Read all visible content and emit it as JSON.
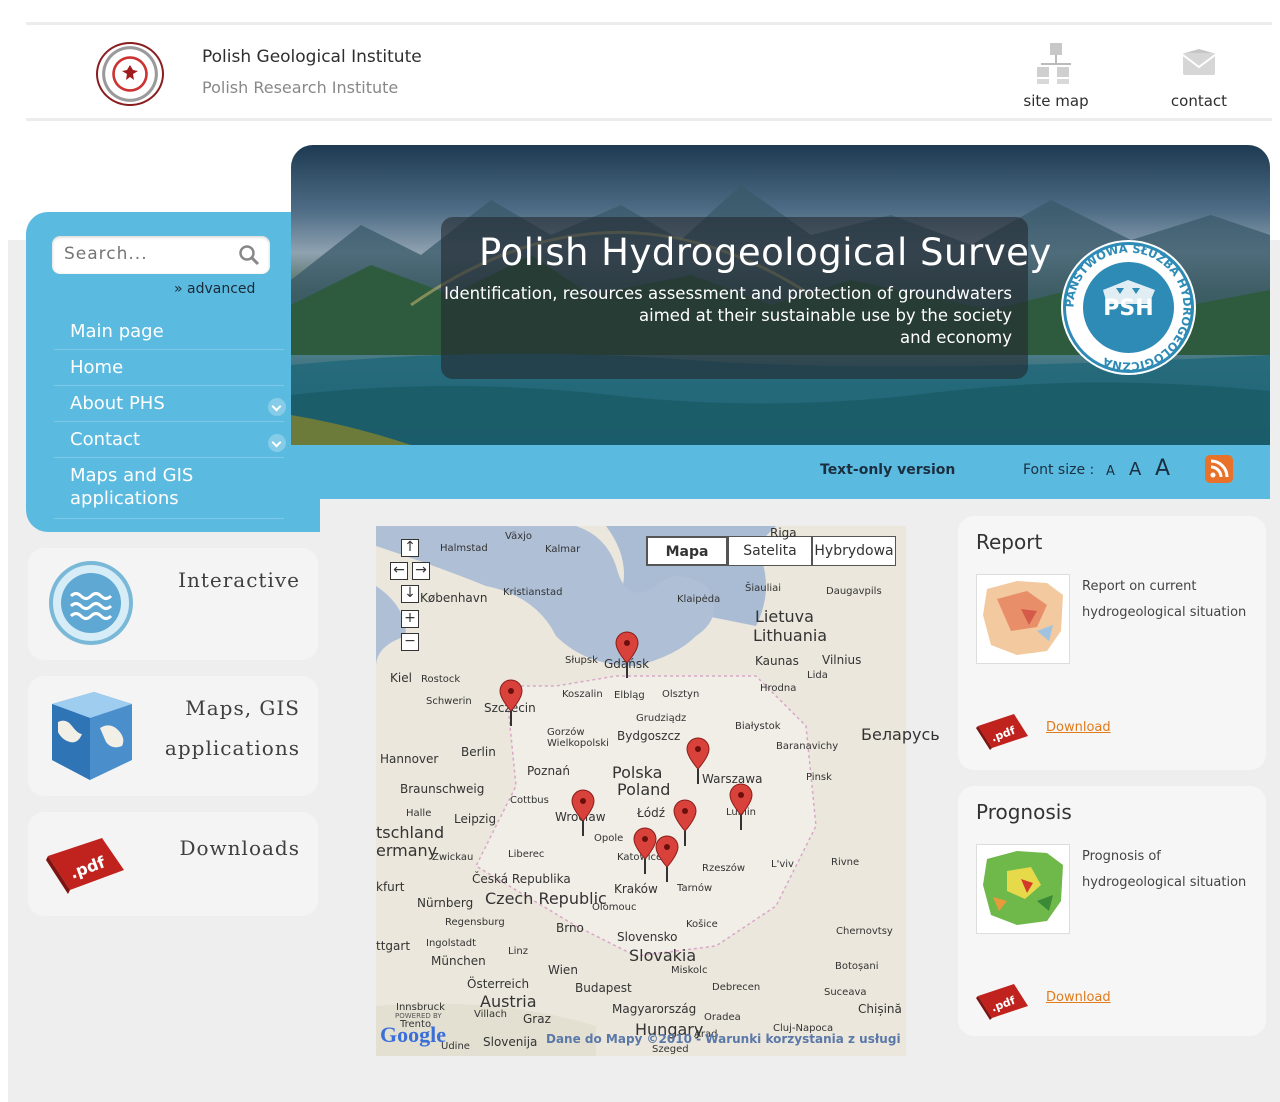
{
  "header": {
    "institute_name": "Polish Geological Institute",
    "institute_sub": "Polish Research Institute",
    "site_map_label": "site map",
    "contact_label": "contact"
  },
  "search": {
    "placeholder": "Search...",
    "advanced_label": "» advanced"
  },
  "menu": {
    "items": [
      {
        "label": "Main page"
      },
      {
        "label": "Home"
      },
      {
        "label": "About PHS"
      },
      {
        "label": "Contact"
      },
      {
        "label": "Maps and GIS applications"
      }
    ]
  },
  "banner": {
    "title": "Polish Hydrogeological Survey",
    "subtitle_1": "Identification, resources assessment and protection of groundwaters",
    "subtitle_2": "aimed at their sustainable use by the society",
    "subtitle_3": "and economy",
    "badge_text": "PSH",
    "badge_ring": "PAŃSTWOWA SŁUŻBA HYDROGEOLOGICZNA"
  },
  "toolbar": {
    "text_only": "Text-only version",
    "font_size_label": "Font size :",
    "font_a_small": "A",
    "font_a_medium": "A",
    "font_a_large": "A"
  },
  "tiles": {
    "interactive": "Interactive",
    "maps_line1": "Maps, GIS",
    "maps_line2": "applications",
    "downloads": "Downloads",
    "pdf_badge": ".pdf"
  },
  "map": {
    "types": [
      "Mapa",
      "Satelita",
      "Hybrydowa"
    ],
    "selected_type": "Mapa",
    "attribution": "Dane do Mapy ©2010 - Warunki korzystania z usługi",
    "powered_by": "POWERED BY",
    "google": "Google",
    "labels": {
      "riga": "Riga",
      "vaxjo": "Växjo",
      "kalmar": "Kalmar",
      "halmstad": "Halmstad",
      "kobenhavn": "København",
      "kristianstad": "Kristianstad",
      "klaipeda": "Klaipėda",
      "siauliai": "Šiauliai",
      "daugavpils": "Daugavpils",
      "lietuva": "Lietuva",
      "lithuania": "Lithuania",
      "kaunas": "Kaunas",
      "vilnius": "Vilnius",
      "slupsk": "Słupsk",
      "gdansk": "Gdańsk",
      "kiel": "Kiel",
      "rostock": "Rostock",
      "schwerin": "Schwerin",
      "szczecin": "Szczecin",
      "koszalin": "Koszalin",
      "elblag": "Elbląg",
      "olsztyn": "Olsztyn",
      "hrodna": "Hrodna",
      "lida": "Lida",
      "grudziadz": "Grudziądz",
      "bialystok": "Białystok",
      "hannover": "Hannover",
      "berlin": "Berlin",
      "gorzow": "Gorzów Wielkopolski",
      "bydgoszcz": "Bydgoszcz",
      "belarus": "Беларусь",
      "baranavichy": "Baranavichy",
      "poznan": "Poznań",
      "polska": "Polska",
      "poland": "Poland",
      "warszawa": "Warszawa",
      "braunschweig": "Braunschweig",
      "cottbus": "Cottbus",
      "pinsk": "Pinsk",
      "halle": "Halle",
      "leipzig": "Leipzig",
      "wroclaw": "Wrocław",
      "lodz": "Łódź",
      "lublin": "Lublin",
      "deutschland": "tschland",
      "germany": "ermany",
      "zwickau": "Zwickau",
      "liberec": "Liberec",
      "opole": "Opole",
      "katowice": "Katowice",
      "rzeszow": "Rzeszów",
      "lviv": "L'viv",
      "rivne": "Rivne",
      "ceska": "Česká Republika",
      "czech": "Czech Republic",
      "krakow": "Kraków",
      "tarnow": "Tarnów",
      "furt": "kfurt",
      "nurnberg": "Nürnberg",
      "olomouc": "Olomouc",
      "regensburg": "Regensburg",
      "brno": "Brno",
      "slovensko": "Slovensko",
      "slovakia": "Slovakia",
      "kosice": "Košice",
      "stuttgart": "ttgart",
      "ingolstadt": "Ingolstadt",
      "linz": "Linz",
      "munchen": "München",
      "wien": "Wien",
      "miskolc": "Miskolc",
      "chernovtsy": "Chernovtsy",
      "osterreich": "Österreich",
      "austria": "Austria",
      "budapest": "Budapest",
      "debrecen": "Debrecen",
      "botosani": "Botoșani",
      "innsbruck": "Innsbruck",
      "villach": "Villach",
      "graz": "Graz",
      "magyar": "Magyarország",
      "hungary": "Hungary",
      "oradea": "Oradea",
      "suceava": "Suceava",
      "cluj": "Cluj-Napoca",
      "chisina": "Chișină",
      "slovenija": "Slovenija",
      "szeged": "Szeged",
      "arad": "Arad",
      "trento": "Trento",
      "udine": "Udine"
    }
  },
  "report": {
    "title": "Report",
    "desc_1": "Report on current",
    "desc_2": "hydrogeological situation",
    "download": "Download"
  },
  "prognosis": {
    "title": "Prognosis",
    "desc_1": "Prognosis of",
    "desc_2": "hydrogeological situation",
    "download": "Download"
  },
  "colors": {
    "accent_blue": "#5bbadf",
    "link_orange": "#e07b1c",
    "pdf_red": "#c0221e",
    "rss_orange": "#e8722a"
  }
}
